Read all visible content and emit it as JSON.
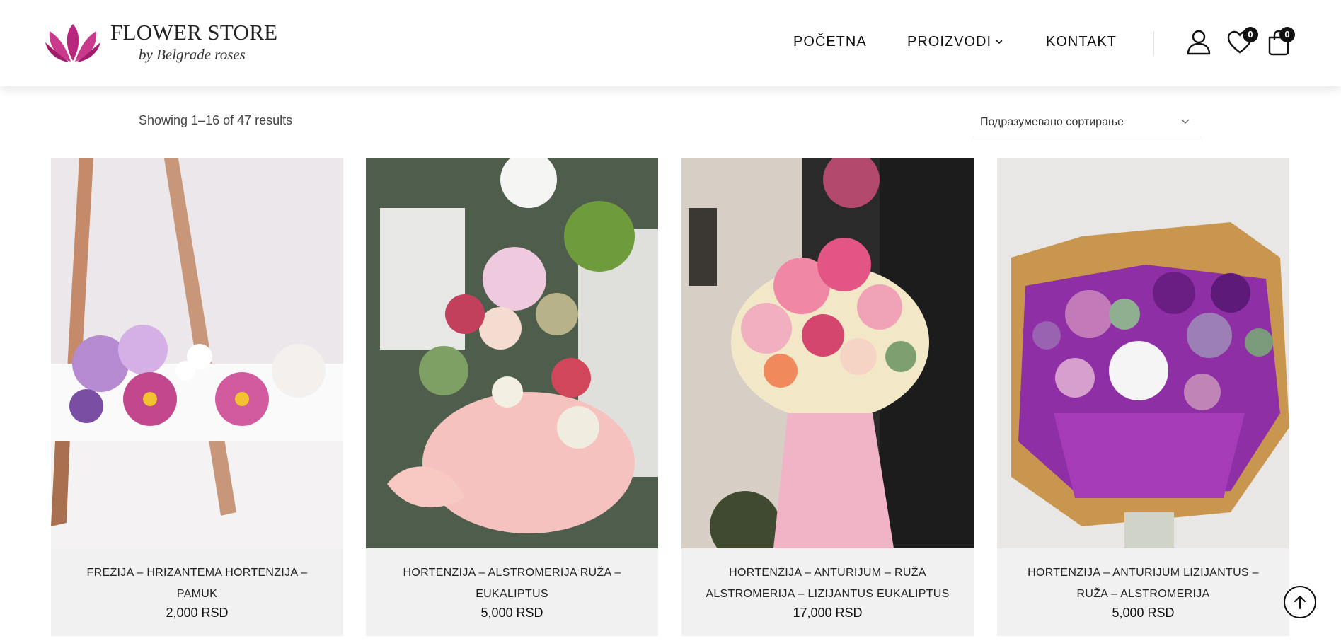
{
  "brand": {
    "title": "FLOWER STORE",
    "subtitle": "by Belgrade roses",
    "accent": "#b8267d"
  },
  "nav": {
    "items": [
      {
        "label": "POČETNA"
      },
      {
        "label": "PROIZVODI"
      },
      {
        "label": "KONTAKT"
      }
    ]
  },
  "header_icons": {
    "account": "user-icon",
    "wishlist": "heart-icon",
    "wishlist_count": "0",
    "cart": "shopping-bag-icon",
    "cart_count": "0"
  },
  "toolbar": {
    "result_count": "Showing 1–16 of 47 results",
    "sort_selected": "Подразумевано сортирање"
  },
  "products": [
    {
      "name": "FREZIJA – HRIZANTEMA HORTENZIJA – PAMUK",
      "price": "2,000 RSD"
    },
    {
      "name": "HORTENZIJA – ALSTROMERIJA RUŽA – EUKALIPTUS",
      "price": "5,000 RSD"
    },
    {
      "name": "HORTENZIJA – ANTURIJUM – RUŽA ALSTROMERIJA – LIZIJANTUS EUKALIPTUS",
      "price": "17,000 RSD"
    },
    {
      "name": "HORTENZIJA – ANTURIJUM LIZIJANTUS – RUŽA – ALSTROMERIJA",
      "price": "5,000 RSD"
    }
  ],
  "scroll_top": "arrow-up-icon"
}
